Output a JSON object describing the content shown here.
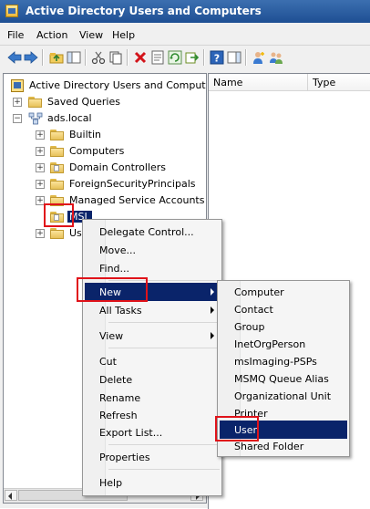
{
  "window": {
    "title": "Active Directory Users and Computers"
  },
  "menubar": [
    {
      "label": "File"
    },
    {
      "label": "Action"
    },
    {
      "label": "View"
    },
    {
      "label": "Help"
    }
  ],
  "tree": {
    "root": "Active Directory Users and Comput",
    "saved_queries": "Saved Queries",
    "domain": "ads.local",
    "builtin": "Builtin",
    "computers": "Computers",
    "domain_controllers": "Domain Controllers",
    "foreign": "ForeignSecurityPrincipals",
    "managed": "Managed Service Accounts",
    "msl": "MSL",
    "users_partial": "Us"
  },
  "list": {
    "col_name": "Name",
    "col_type": "Type"
  },
  "context_menu": {
    "delegate": "Delegate Control...",
    "move": "Move...",
    "find": "Find...",
    "new": "New",
    "all_tasks": "All Tasks",
    "view": "View",
    "cut": "Cut",
    "delete": "Delete",
    "rename": "Rename",
    "refresh": "Refresh",
    "export": "Export List...",
    "properties": "Properties",
    "help": "Help"
  },
  "submenu": {
    "computer": "Computer",
    "contact": "Contact",
    "group": "Group",
    "inetorgperson": "InetOrgPerson",
    "imaging": "msImaging-PSPs",
    "msmq": "MSMQ Queue Alias",
    "ou": "Organizational Unit",
    "printer": "Printer",
    "user": "User",
    "shared_folder": "Shared Folder"
  },
  "colors": {
    "titlebar": "#1e4f93",
    "selection": "#0a246a",
    "highlight_box": "#e0131a"
  }
}
